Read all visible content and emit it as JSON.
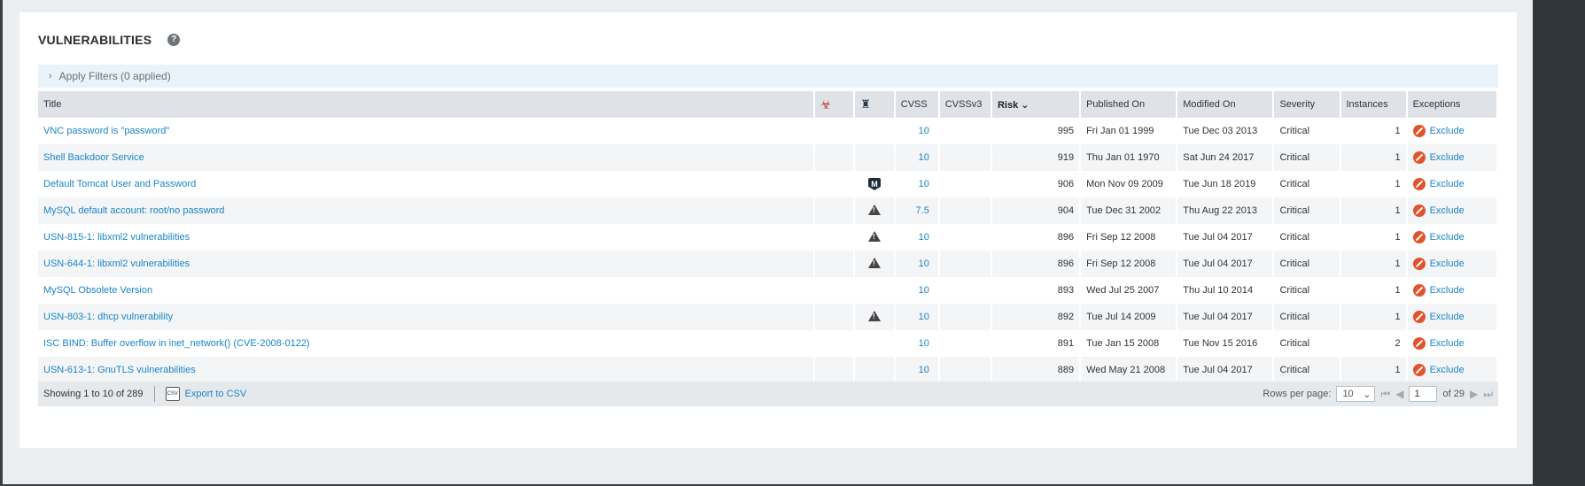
{
  "panel": {
    "title": "VULNERABILITIES",
    "help_icon": "?",
    "filters_label": "Apply Filters (0 applied)"
  },
  "columns": {
    "title": "Title",
    "malware_icon": "biohazard-icon",
    "exploit_icon": "metasploit-icon",
    "cvss": "CVSS",
    "cvss3": "CVSSv3",
    "risk": "Risk",
    "published": "Published On",
    "modified": "Modified On",
    "severity": "Severity",
    "instances": "Instances",
    "exceptions": "Exceptions"
  },
  "rows": [
    {
      "title": "VNC password is \"password\"",
      "exploit": "",
      "cvss": "10",
      "cvss3": "",
      "risk": "995",
      "published": "Fri Jan 01 1999",
      "modified": "Tue Dec 03 2013",
      "severity": "Critical",
      "instances": "1",
      "exception": "Exclude"
    },
    {
      "title": "Shell Backdoor Service",
      "exploit": "",
      "cvss": "10",
      "cvss3": "",
      "risk": "919",
      "published": "Thu Jan 01 1970",
      "modified": "Sat Jun 24 2017",
      "severity": "Critical",
      "instances": "1",
      "exception": "Exclude"
    },
    {
      "title": "Default Tomcat User and Password",
      "exploit": "metasploit",
      "cvss": "10",
      "cvss3": "",
      "risk": "906",
      "published": "Mon Nov 09 2009",
      "modified": "Tue Jun 18 2019",
      "severity": "Critical",
      "instances": "1",
      "exception": "Exclude"
    },
    {
      "title": "MySQL default account: root/no password",
      "exploit": "exploit",
      "cvss": "7.5",
      "cvss3": "",
      "risk": "904",
      "published": "Tue Dec 31 2002",
      "modified": "Thu Aug 22 2013",
      "severity": "Critical",
      "instances": "1",
      "exception": "Exclude"
    },
    {
      "title": "USN-815-1: libxml2 vulnerabilities",
      "exploit": "exploit",
      "cvss": "10",
      "cvss3": "",
      "risk": "896",
      "published": "Fri Sep 12 2008",
      "modified": "Tue Jul 04 2017",
      "severity": "Critical",
      "instances": "1",
      "exception": "Exclude"
    },
    {
      "title": "USN-644-1: libxml2 vulnerabilities",
      "exploit": "exploit",
      "cvss": "10",
      "cvss3": "",
      "risk": "896",
      "published": "Fri Sep 12 2008",
      "modified": "Tue Jul 04 2017",
      "severity": "Critical",
      "instances": "1",
      "exception": "Exclude"
    },
    {
      "title": "MySQL Obsolete Version",
      "exploit": "",
      "cvss": "10",
      "cvss3": "",
      "risk": "893",
      "published": "Wed Jul 25 2007",
      "modified": "Thu Jul 10 2014",
      "severity": "Critical",
      "instances": "1",
      "exception": "Exclude"
    },
    {
      "title": "USN-803-1: dhcp vulnerability",
      "exploit": "exploit",
      "cvss": "10",
      "cvss3": "",
      "risk": "892",
      "published": "Tue Jul 14 2009",
      "modified": "Tue Jul 04 2017",
      "severity": "Critical",
      "instances": "1",
      "exception": "Exclude"
    },
    {
      "title": "ISC BIND: Buffer overflow in inet_network() (CVE-2008-0122)",
      "exploit": "",
      "cvss": "10",
      "cvss3": "",
      "risk": "891",
      "published": "Tue Jan 15 2008",
      "modified": "Tue Nov 15 2016",
      "severity": "Critical",
      "instances": "2",
      "exception": "Exclude"
    },
    {
      "title": "USN-613-1: GnuTLS vulnerabilities",
      "exploit": "",
      "cvss": "10",
      "cvss3": "",
      "risk": "889",
      "published": "Wed May 21 2008",
      "modified": "Tue Jul 04 2017",
      "severity": "Critical",
      "instances": "1",
      "exception": "Exclude"
    }
  ],
  "footer": {
    "showing": "Showing 1 to 10 of 289",
    "export_label": "Export to CSV",
    "rows_per_page_label": "Rows per page:",
    "rows_per_page_value": "10",
    "page_value": "1",
    "page_of": "of 29"
  },
  "colors": {
    "link": "#1a85c7",
    "header_bg": "#dfe3e7",
    "filter_bg": "#eaf3f9",
    "exclude_icon": "#e2532b"
  }
}
